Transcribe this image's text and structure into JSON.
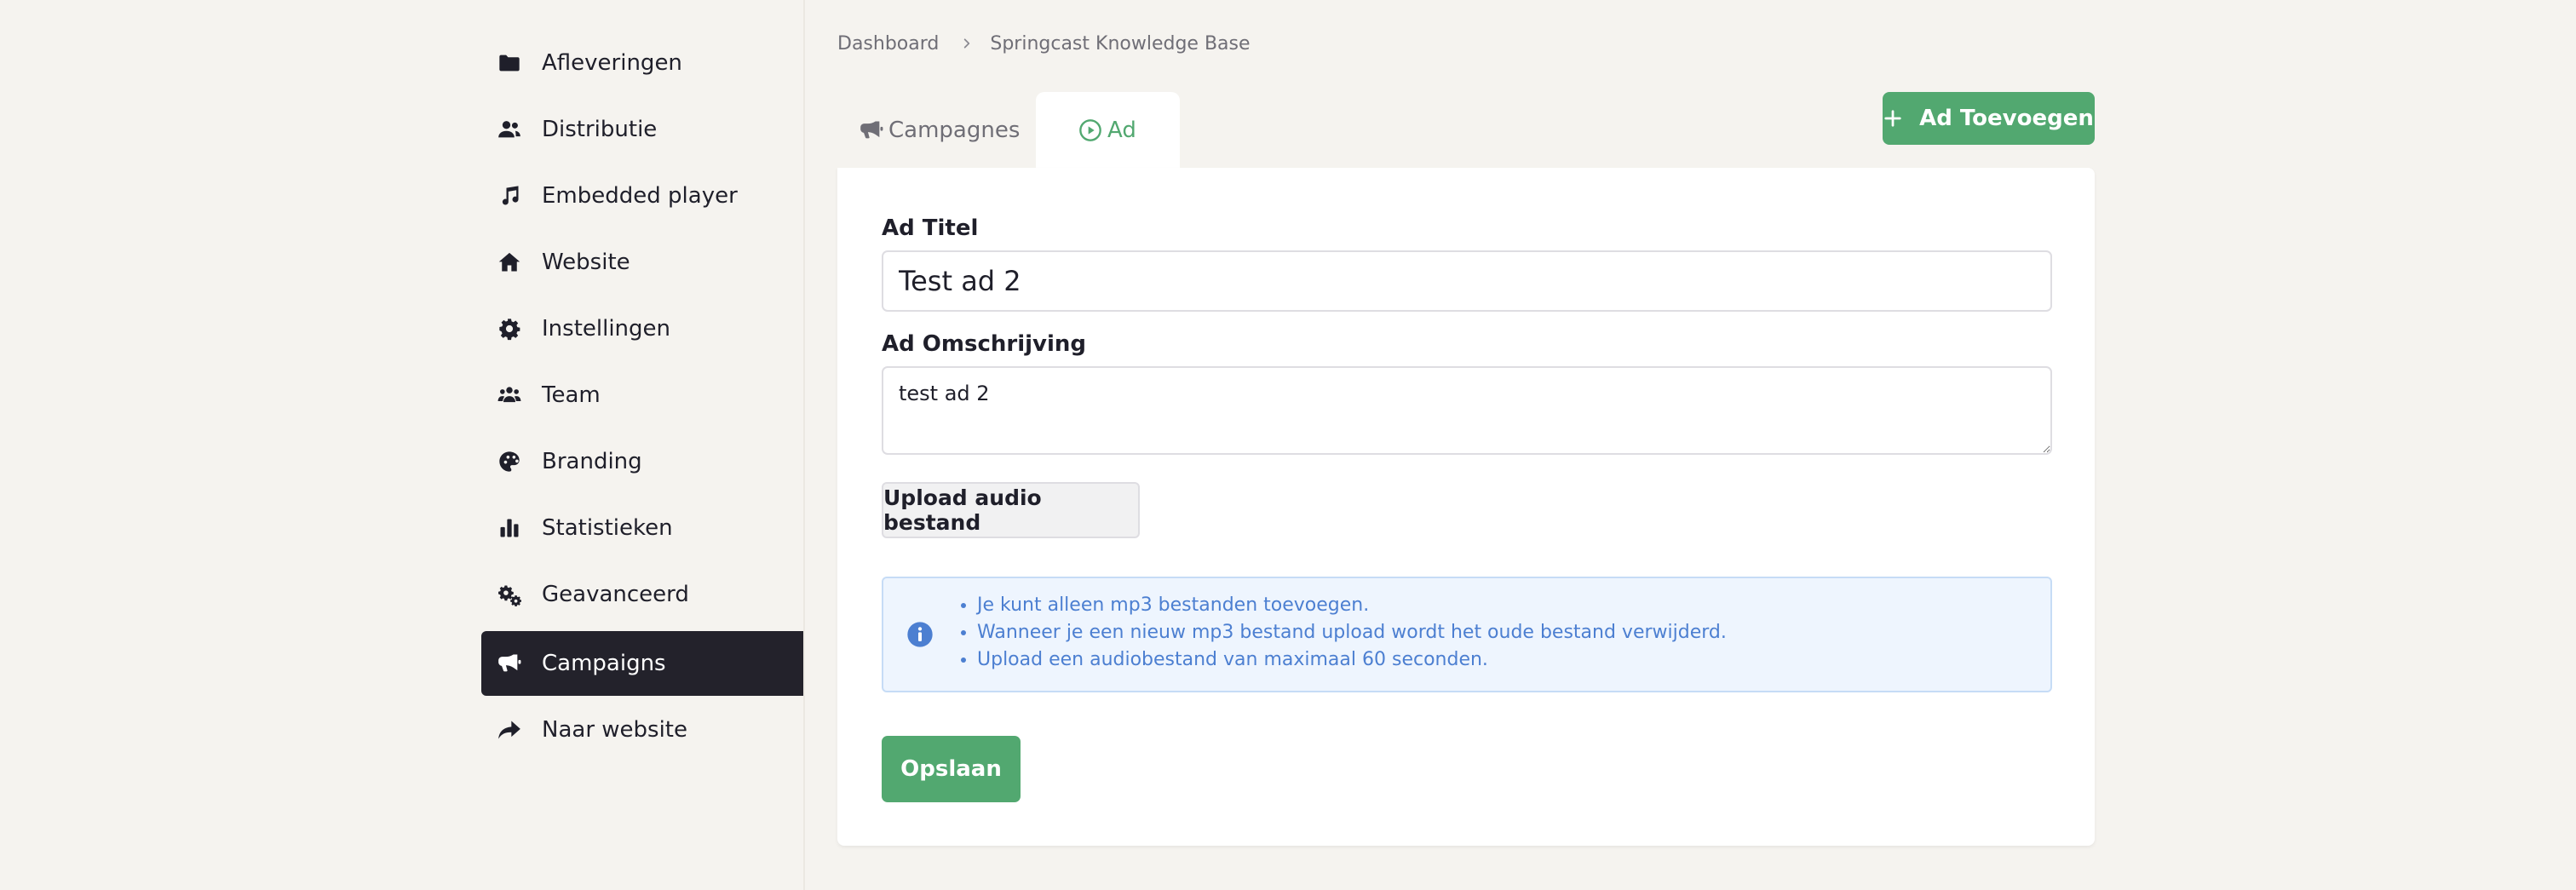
{
  "sidebar": {
    "items": [
      {
        "label": "Afleveringen",
        "icon": "folder-icon"
      },
      {
        "label": "Distributie",
        "icon": "users-icon"
      },
      {
        "label": "Embedded player",
        "icon": "music-icon"
      },
      {
        "label": "Website",
        "icon": "home-icon"
      },
      {
        "label": "Instellingen",
        "icon": "gear-icon"
      },
      {
        "label": "Team",
        "icon": "people-group-icon"
      },
      {
        "label": "Branding",
        "icon": "palette-icon"
      },
      {
        "label": "Statistieken",
        "icon": "bar-chart-icon"
      },
      {
        "label": "Geavanceerd",
        "icon": "gears-icon"
      },
      {
        "label": "Campaigns",
        "icon": "megaphone-icon",
        "active": true
      },
      {
        "label": "Naar website",
        "icon": "share-arrow-icon"
      }
    ]
  },
  "breadcrumb": {
    "items": [
      "Dashboard",
      "Springcast Knowledge Base"
    ]
  },
  "tabs": {
    "campagnes": "Campagnes",
    "ad": "Ad",
    "active": "ad"
  },
  "toolbar": {
    "add_label": "Ad Toevoegen"
  },
  "form": {
    "title_label": "Ad Titel",
    "title_value": "Test ad 2",
    "description_label": "Ad Omschrijving",
    "description_value": "test ad 2",
    "upload_label": "Upload audio bestand",
    "info_items": [
      "Je kunt alleen mp3 bestanden toevoegen.",
      "Wanneer je een nieuw mp3 bestand upload wordt het oude bestand verwijderd.",
      "Upload een audiobestand van maximaal 60 seconden."
    ],
    "save_label": "Opslaan"
  },
  "colors": {
    "accent_green": "#52a870",
    "sidebar_active_bg": "#23222b",
    "info_blue": "#4c7fd1",
    "page_bg": "#f5f3ef"
  }
}
